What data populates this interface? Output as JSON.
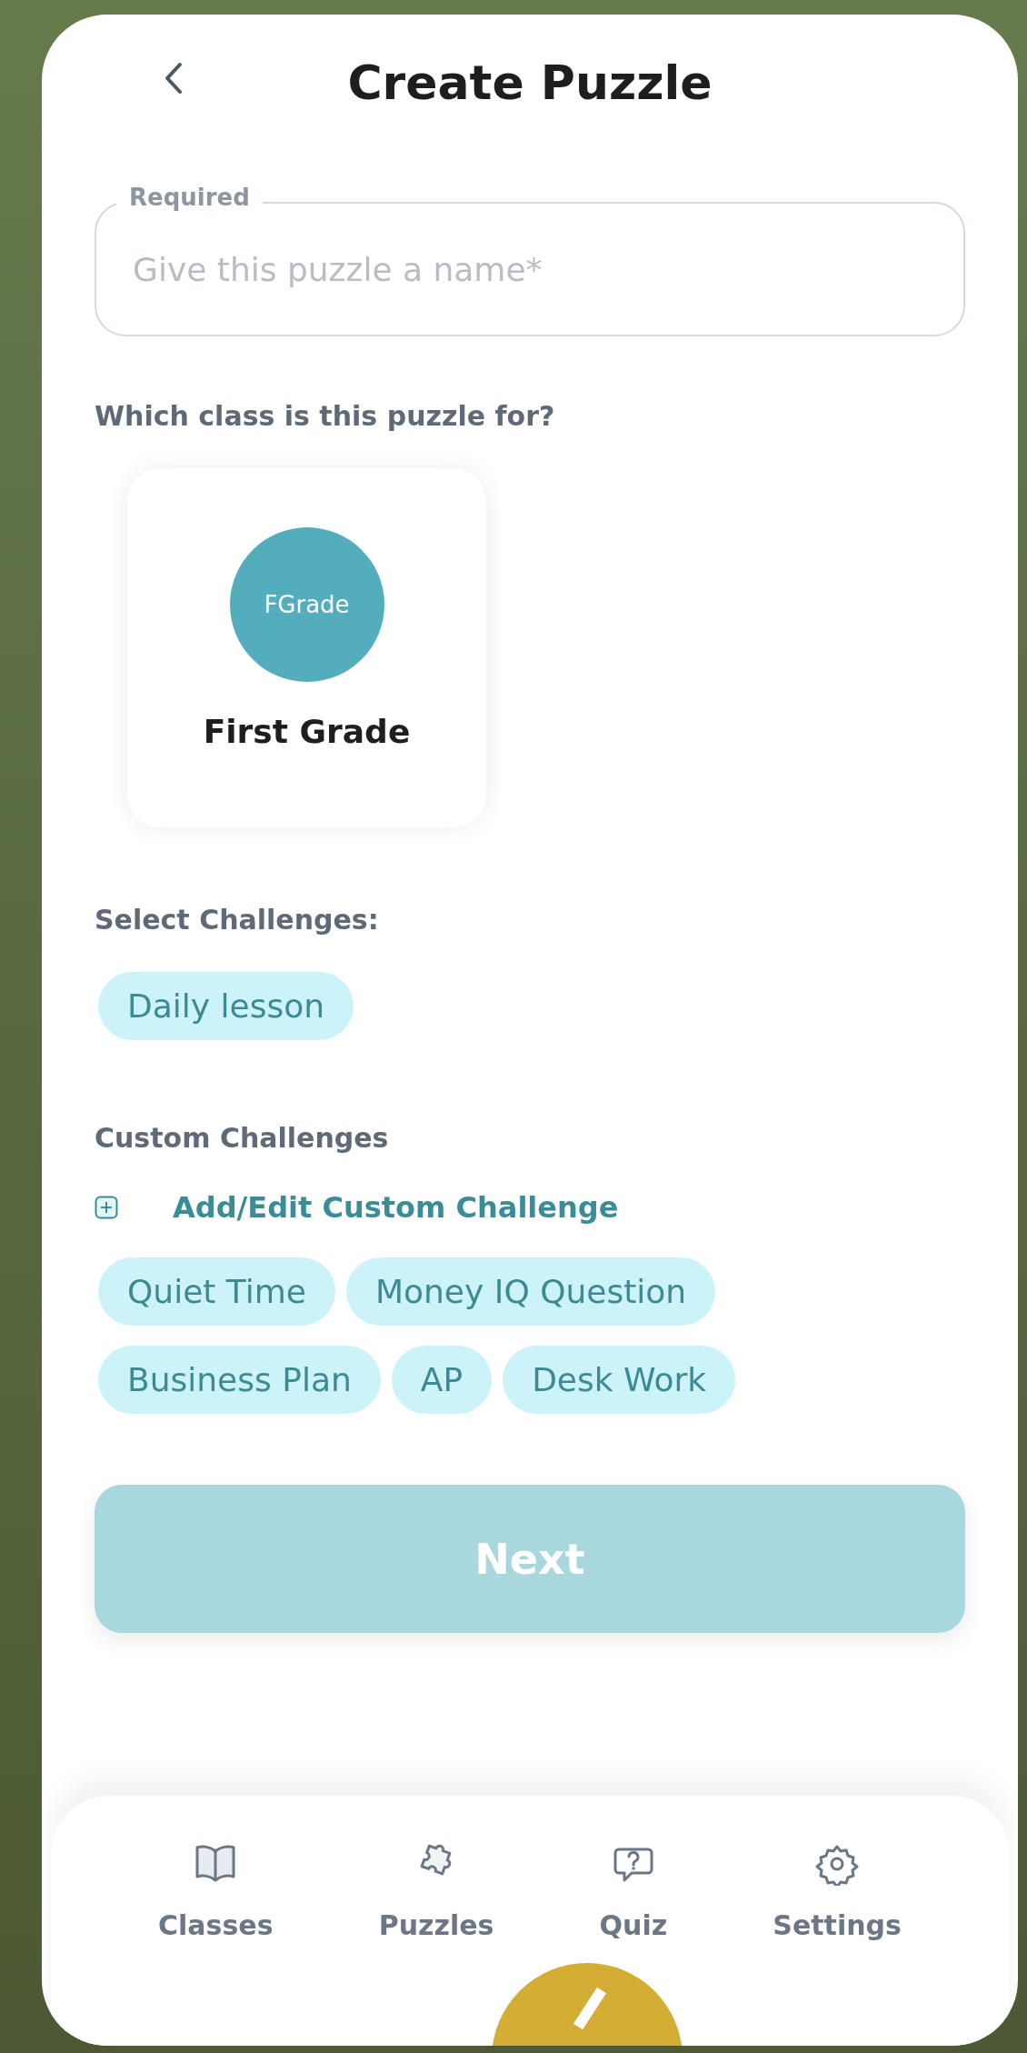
{
  "header": {
    "title": "Create Puzzle"
  },
  "name_field": {
    "label": "Required",
    "placeholder": "Give this puzzle a name*"
  },
  "class_section": {
    "heading": "Which class is this puzzle for?",
    "classes": [
      {
        "avatar_text": "FGrade",
        "name": "First Grade",
        "color": "#53adbd"
      }
    ]
  },
  "challenges": {
    "heading": "Select Challenges:",
    "items": [
      "Daily lesson"
    ]
  },
  "custom_challenges": {
    "heading": "Custom Challenges",
    "add_link": "Add/Edit Custom Challenge",
    "items": [
      "Quiet Time",
      "Money IQ Question",
      "Business Plan",
      "AP",
      "Desk Work"
    ]
  },
  "next_button": {
    "label": "Next",
    "disabled": true
  },
  "bottom_nav": [
    {
      "label": "Classes"
    },
    {
      "label": "Puzzles"
    },
    {
      "label": "Quiz"
    },
    {
      "label": "Settings"
    }
  ]
}
